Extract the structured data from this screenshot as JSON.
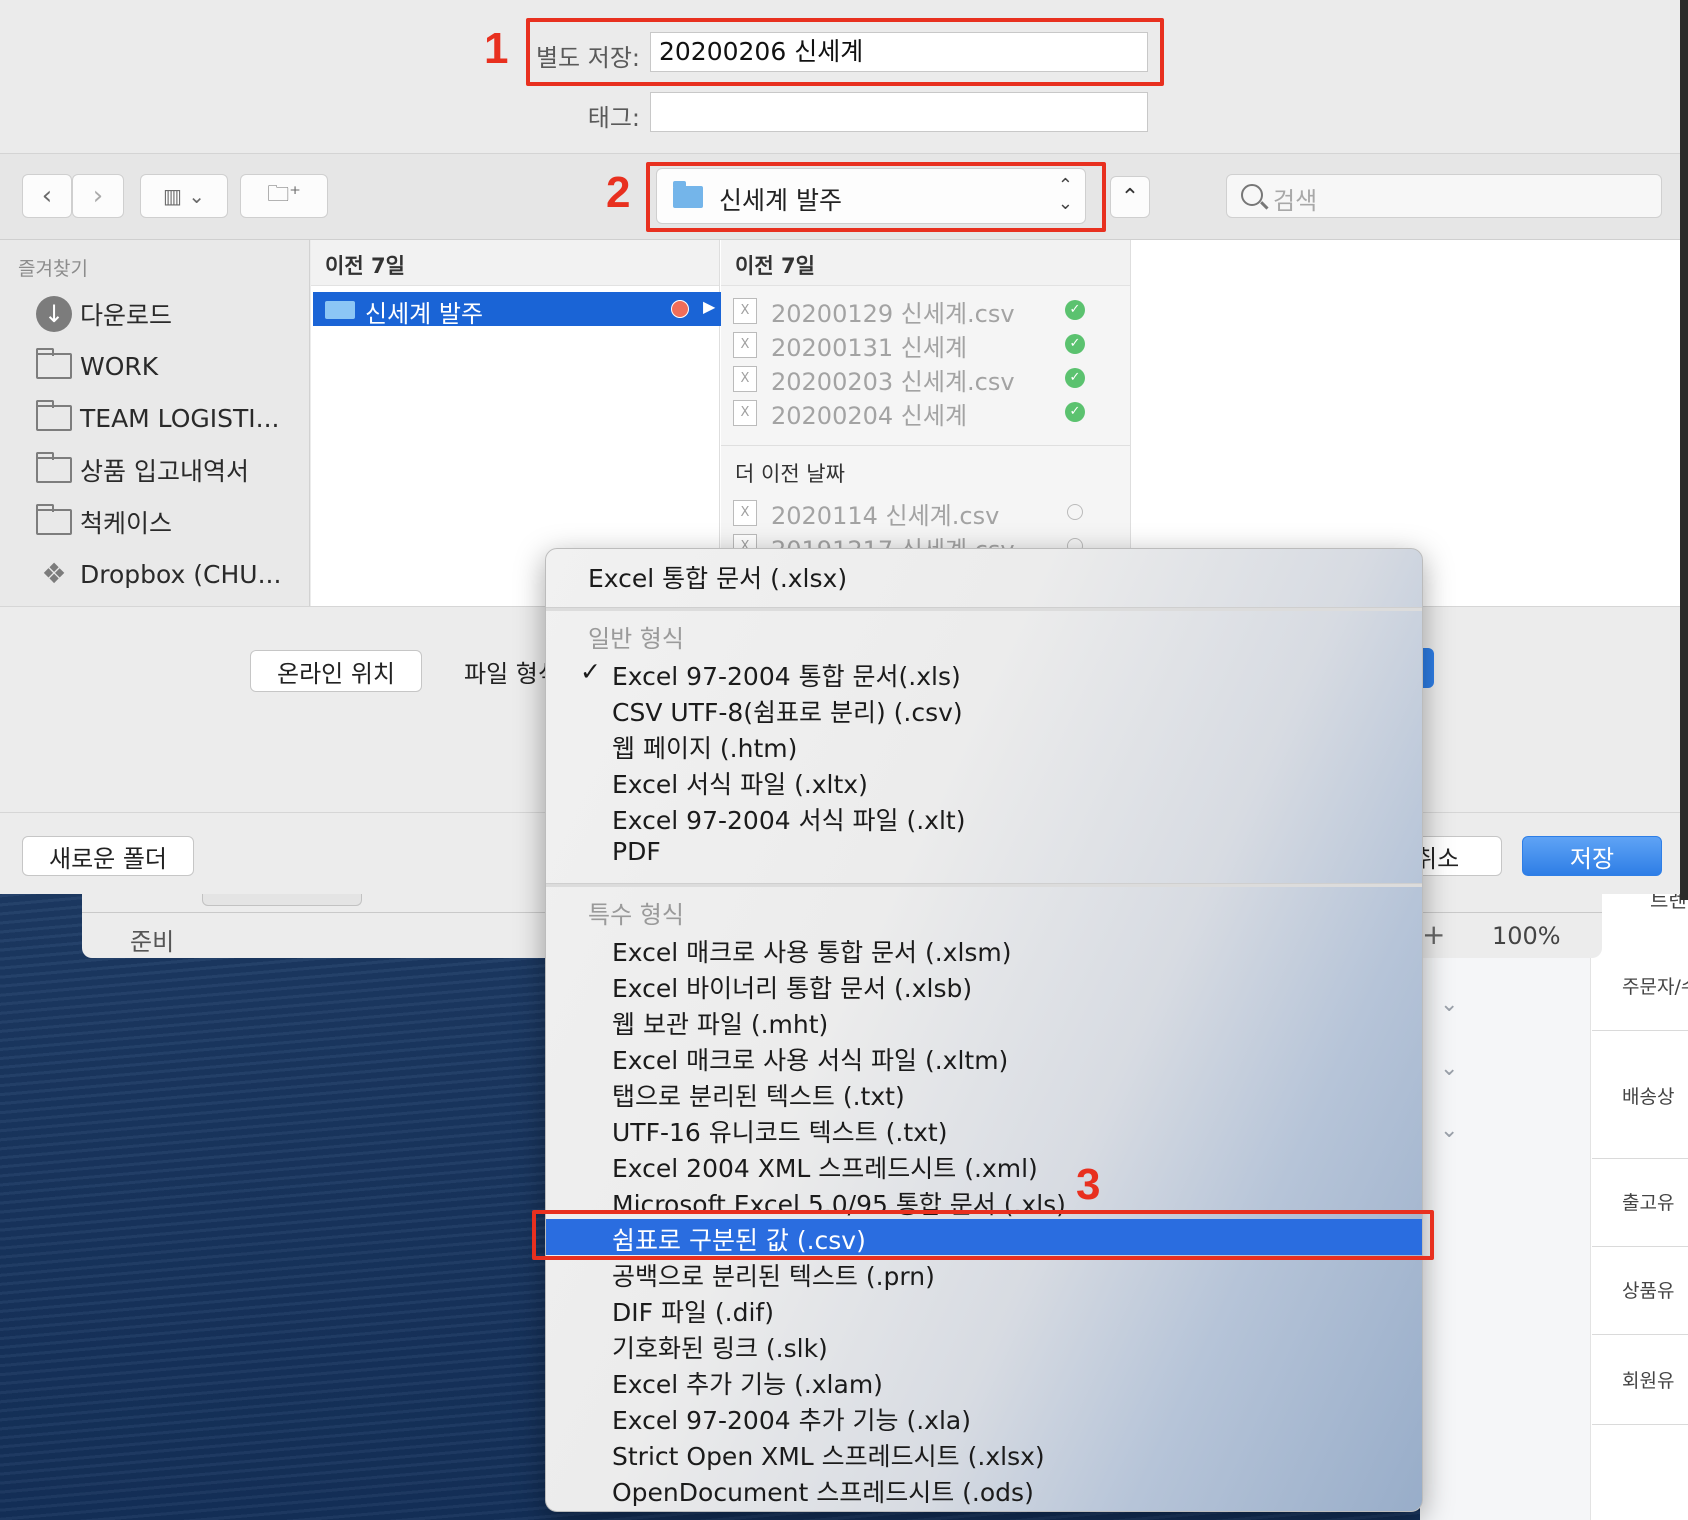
{
  "save_dialog": {
    "save_as_label": "별도 저장:",
    "save_as_value": "20200206 신세계",
    "tags_label": "태그:",
    "tags_value": "",
    "location": "신세계 발주",
    "search_placeholder": "검색",
    "sidebar": {
      "title": "즐겨찾기",
      "items": [
        {
          "label": "다운로드",
          "icon": "download-icon"
        },
        {
          "label": "WORK",
          "icon": "folder-icon"
        },
        {
          "label": "TEAM LOGISTI...",
          "icon": "folder-icon"
        },
        {
          "label": "상품 입고내역서",
          "icon": "folder-icon"
        },
        {
          "label": "척케이스",
          "icon": "folder-icon"
        },
        {
          "label": "Dropbox (CHU...",
          "icon": "dropbox-icon"
        }
      ]
    },
    "column1": {
      "header": "이전 7일",
      "selected_folder": "신세계 발주"
    },
    "column2": {
      "header": "이전 7일",
      "files": [
        {
          "name": "20200129 신세계.csv",
          "status": "synced"
        },
        {
          "name": "20200131 신세계",
          "status": "synced"
        },
        {
          "name": "20200203 신세계.csv",
          "status": "synced"
        },
        {
          "name": "20200204 신세계",
          "status": "synced"
        }
      ],
      "older_header": "더 이전 날짜",
      "older_files": [
        {
          "name": "2020114 신세계.csv",
          "status": "cloud"
        },
        {
          "name": "20191217 신세계.csv",
          "status": "cloud"
        }
      ]
    },
    "online_location_button": "온라인 위치",
    "file_format_label": "파일 형식",
    "new_folder_button": "새로운 폴더",
    "cancel_button_partial": "취소",
    "save_button": "저장"
  },
  "format_menu": {
    "top_item": "Excel 통합 문서 (.xlsx)",
    "general_heading": "일반 형식",
    "general_items": [
      {
        "label": "Excel 97-2004 통합 문서(.xls)",
        "checked": true
      },
      {
        "label": "CSV UTF-8(쉼표로 분리) (.csv)",
        "checked": false
      },
      {
        "label": "웹 페이지 (.htm)",
        "checked": false
      },
      {
        "label": "Excel 서식 파일 (.xltx)",
        "checked": false
      },
      {
        "label": "Excel 97-2004 서식 파일 (.xlt)",
        "checked": false
      },
      {
        "label": "PDF",
        "checked": false
      }
    ],
    "special_heading": "특수 형식",
    "special_items": [
      {
        "label": "Excel 매크로 사용 통합 문서 (.xlsm)",
        "highlighted": false
      },
      {
        "label": "Excel 바이너리 통합 문서 (.xlsb)",
        "highlighted": false
      },
      {
        "label": "웹 보관 파일 (.mht)",
        "highlighted": false
      },
      {
        "label": "Excel 매크로 사용 서식 파일 (.xltm)",
        "highlighted": false
      },
      {
        "label": "탭으로 분리된 텍스트 (.txt)",
        "highlighted": false
      },
      {
        "label": "UTF-16 유니코드 텍스트 (.txt)",
        "highlighted": false
      },
      {
        "label": "Excel 2004 XML 스프레드시트 (.xml)",
        "highlighted": false
      },
      {
        "label": "Microsoft Excel 5.0/95 통합 문서 (.xls)",
        "highlighted": false
      },
      {
        "label": "쉼표로 구분된 값 (.csv)",
        "highlighted": true
      },
      {
        "label": "공백으로 분리된 텍스트 (.prn)",
        "highlighted": false
      },
      {
        "label": "DIF 파일 (.dif)",
        "highlighted": false
      },
      {
        "label": "기호화된 링크 (.slk)",
        "highlighted": false
      },
      {
        "label": "Excel 추가 기능 (.xlam)",
        "highlighted": false
      },
      {
        "label": "Excel 97-2004 추가 기능 (.xla)",
        "highlighted": false
      },
      {
        "label": "Strict Open XML 스프레드시트 (.xlsx)",
        "highlighted": false
      },
      {
        "label": "OpenDocument 스프레드시트 (.ods)",
        "highlighted": false
      }
    ]
  },
  "annotations": [
    "1",
    "2",
    "3"
  ],
  "excel_window": {
    "status": "준비",
    "zoom": "100%",
    "zoom_plus": "+"
  },
  "webpage": {
    "labels": [
      "주문자/수",
      "배송상",
      "출고유",
      "상품유",
      "회원유"
    ],
    "partial_top": "트렌"
  },
  "colors": {
    "annotation_red": "#e8301f",
    "selection_blue": "#1a64d6",
    "menu_highlight": "#2a6de0",
    "save_button": "#2e7ee6",
    "sync_green": "#5bc26f"
  }
}
